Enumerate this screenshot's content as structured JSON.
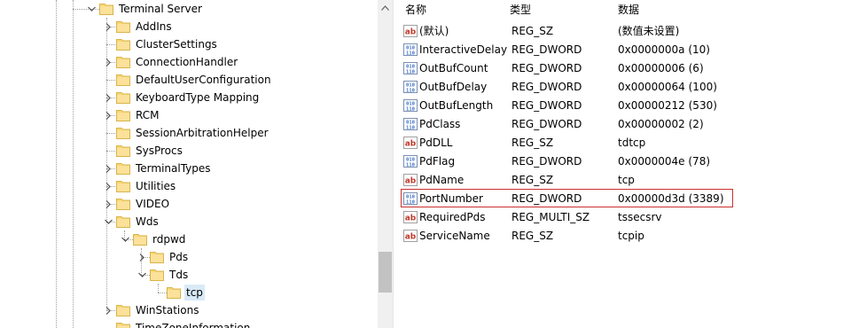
{
  "tree": {
    "items": [
      {
        "label": "Terminal Server",
        "state": "expanded"
      },
      {
        "label": "AddIns",
        "state": "collapsed"
      },
      {
        "label": "ClusterSettings",
        "state": "none"
      },
      {
        "label": "ConnectionHandler",
        "state": "collapsed"
      },
      {
        "label": "DefaultUserConfiguration",
        "state": "none"
      },
      {
        "label": "KeyboardType Mapping",
        "state": "collapsed"
      },
      {
        "label": "RCM",
        "state": "collapsed"
      },
      {
        "label": "SessionArbitrationHelper",
        "state": "none"
      },
      {
        "label": "SysProcs",
        "state": "none"
      },
      {
        "label": "TerminalTypes",
        "state": "collapsed"
      },
      {
        "label": "Utilities",
        "state": "collapsed"
      },
      {
        "label": "VIDEO",
        "state": "collapsed"
      },
      {
        "label": "Wds",
        "state": "expanded"
      },
      {
        "label": "rdpwd",
        "state": "expanded"
      },
      {
        "label": "Pds",
        "state": "collapsed"
      },
      {
        "label": "Tds",
        "state": "expanded"
      },
      {
        "label": "tcp",
        "state": "none",
        "selected": true
      },
      {
        "label": "WinStations",
        "state": "collapsed"
      },
      {
        "label": "TimeZoneInformation",
        "state": "none"
      }
    ]
  },
  "list": {
    "headers": {
      "name": "名称",
      "type": "类型",
      "data": "数据"
    },
    "rows": [
      {
        "icon": "string-value-icon",
        "name": "(默认)",
        "type": "REG_SZ",
        "data": "(数值未设置)"
      },
      {
        "icon": "binary-value-icon",
        "name": "InteractiveDelay",
        "type": "REG_DWORD",
        "data": "0x0000000a (10)"
      },
      {
        "icon": "binary-value-icon",
        "name": "OutBufCount",
        "type": "REG_DWORD",
        "data": "0x00000006 (6)"
      },
      {
        "icon": "binary-value-icon",
        "name": "OutBufDelay",
        "type": "REG_DWORD",
        "data": "0x00000064 (100)"
      },
      {
        "icon": "binary-value-icon",
        "name": "OutBufLength",
        "type": "REG_DWORD",
        "data": "0x00000212 (530)"
      },
      {
        "icon": "binary-value-icon",
        "name": "PdClass",
        "type": "REG_DWORD",
        "data": "0x00000002 (2)"
      },
      {
        "icon": "string-value-icon",
        "name": "PdDLL",
        "type": "REG_SZ",
        "data": "tdtcp"
      },
      {
        "icon": "binary-value-icon",
        "name": "PdFlag",
        "type": "REG_DWORD",
        "data": "0x0000004e (78)"
      },
      {
        "icon": "string-value-icon",
        "name": "PdName",
        "type": "REG_SZ",
        "data": "tcp"
      },
      {
        "icon": "binary-value-icon",
        "name": "PortNumber",
        "type": "REG_DWORD",
        "data": "0x00000d3d (3389)",
        "highlighted": true
      },
      {
        "icon": "string-value-icon",
        "name": "RequiredPds",
        "type": "REG_MULTI_SZ",
        "data": "tssecsrv"
      },
      {
        "icon": "string-value-icon",
        "name": "ServiceName",
        "type": "REG_SZ",
        "data": "tcpip"
      }
    ]
  },
  "colors": {
    "folder": "#f8d775",
    "selection": "#d9eaf7",
    "highlight_border": "#c9302c",
    "binary_icon": "#3a6fc7",
    "string_icon": "#c0392b"
  }
}
